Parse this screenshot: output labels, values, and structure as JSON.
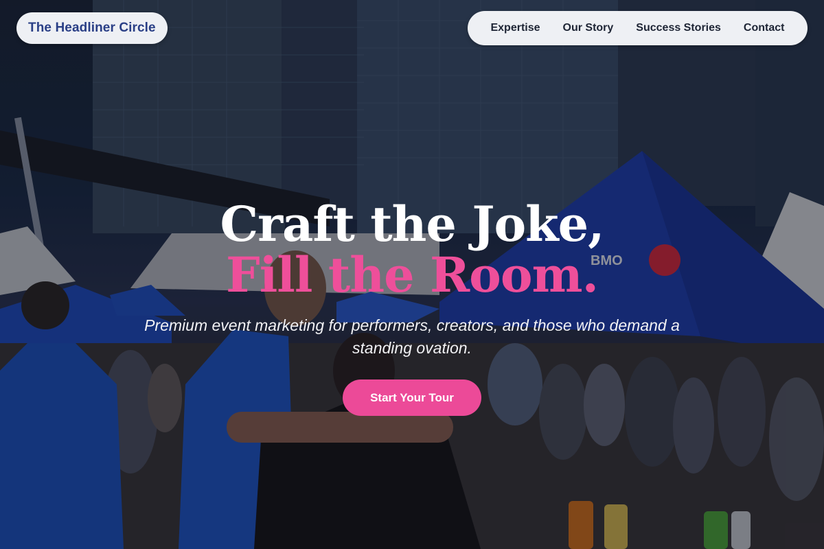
{
  "brand": {
    "label": "The Headliner Circle"
  },
  "nav": {
    "items": [
      {
        "label": "Expertise"
      },
      {
        "label": "Our Story"
      },
      {
        "label": "Success Stories"
      },
      {
        "label": "Contact"
      }
    ]
  },
  "hero": {
    "headline_line1": "Craft the Joke,",
    "headline_line2": "Fill the Room.",
    "subheadline": "Premium event marketing for performers, creators, and those who demand a standing ovation.",
    "cta_label": "Start Your Tour"
  },
  "background": {
    "tent_logo_text": "BMO"
  },
  "colors": {
    "accent": "#ec4a98",
    "brand_text": "#2a3f86",
    "pill_bg": "#eef0f4",
    "tent_blue": "#1f3fb0"
  }
}
